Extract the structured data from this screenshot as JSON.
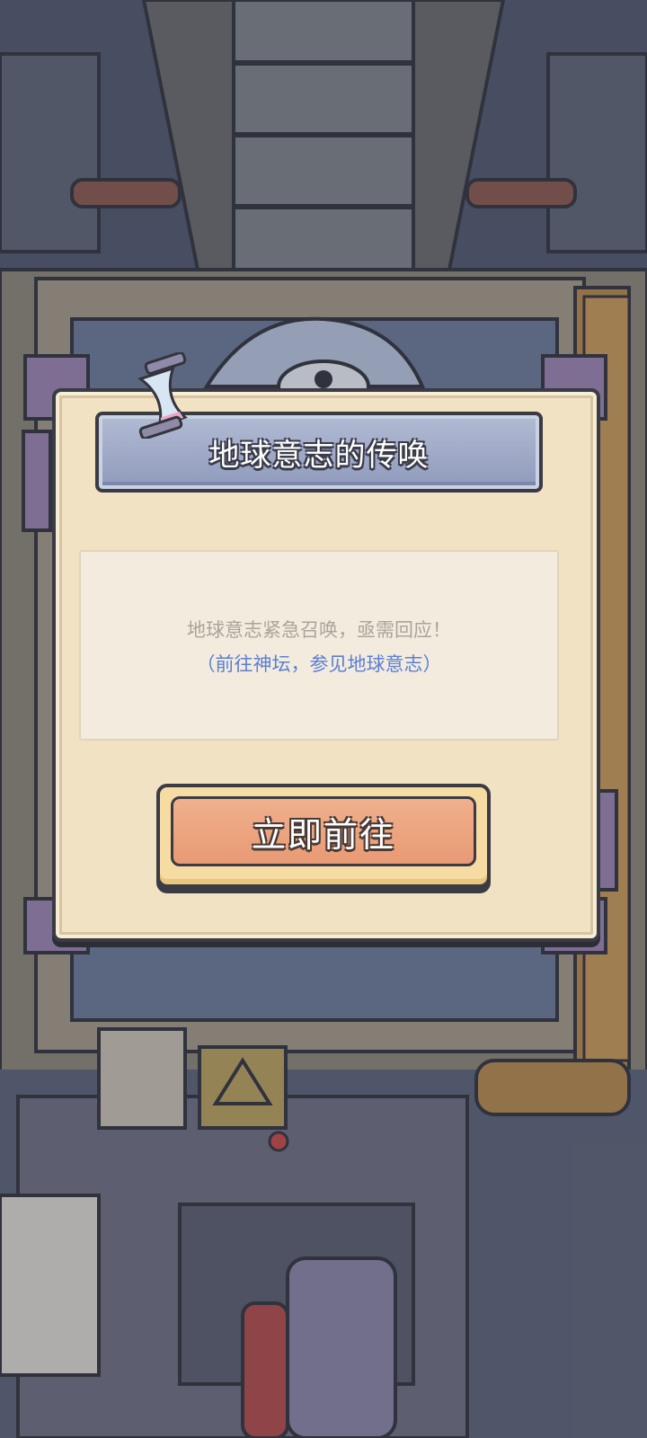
{
  "dialog": {
    "title": "地球意志的传唤",
    "message_line1": "地球意志紧急召唤，亟需回应！",
    "message_line2": "（前往神坛，参见地球意志）",
    "button_label": "立即前往"
  },
  "icons": {
    "hourglass": "hourglass-icon",
    "eye_pyramid": "eye-pyramid-icon",
    "shrine": "shrine-icon"
  },
  "colors": {
    "dialog_bg": "#f1e2c4",
    "title_bar": "#9aa5c4",
    "button": "#eca07a",
    "link_text": "#5b7fd4"
  }
}
